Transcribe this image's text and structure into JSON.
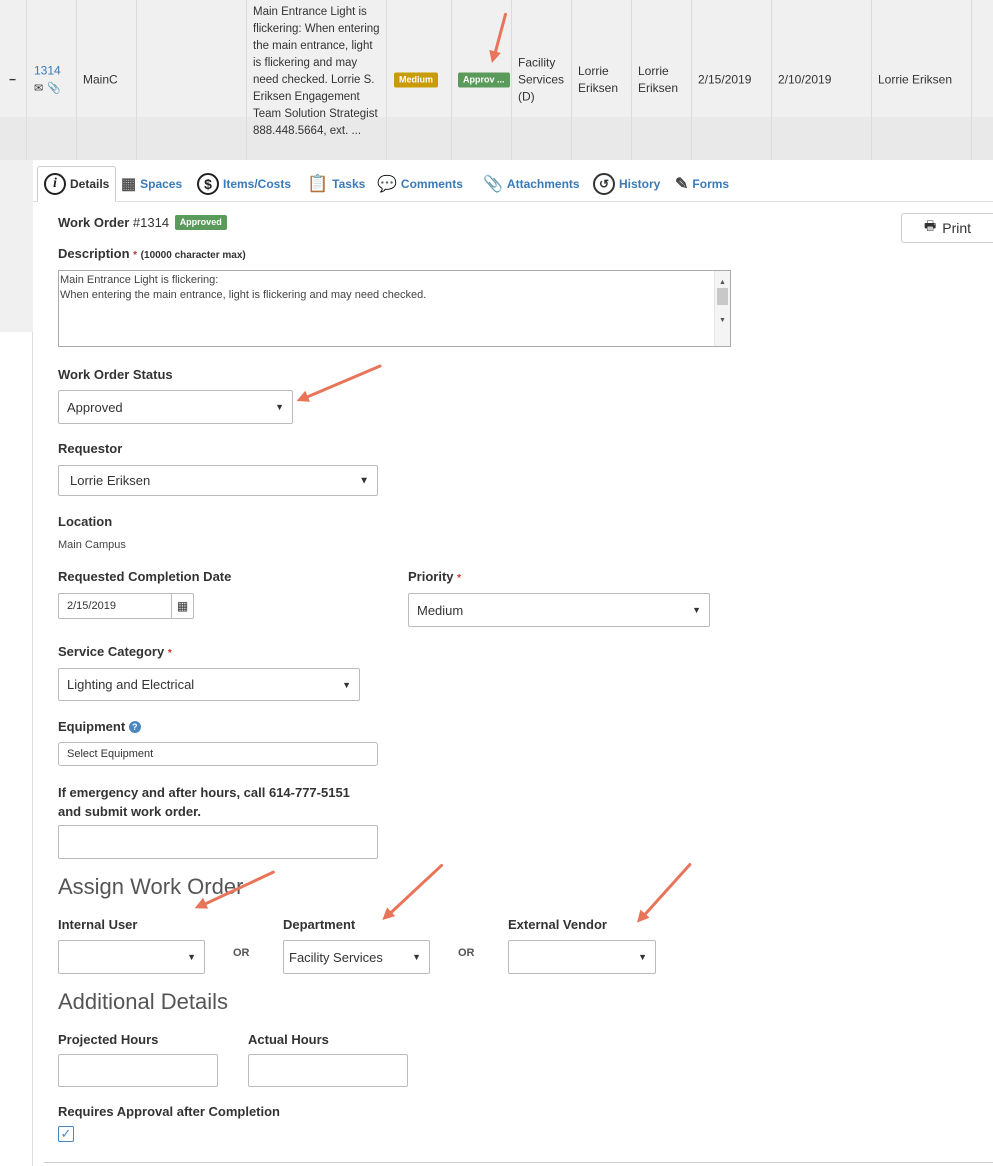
{
  "row": {
    "collapse": "−",
    "id": "1314",
    "location": "MainC",
    "description": "Main Entrance Light is flickering: When entering the main entrance, light is flickering and may need checked. Lorrie S. Eriksen Engagement Team Solution Strategist 888.448.5664, ext. ...",
    "priority": "Medium",
    "status": "Approv ...",
    "department": "Facility Services (D)",
    "requestor": "Lorrie Eriksen",
    "created_by": "Lorrie Eriksen",
    "due": "2/15/2019",
    "requested": "2/10/2019",
    "contact": "Lorrie Eriksen"
  },
  "tabs": [
    "Details",
    "Spaces",
    "Items/Costs",
    "Tasks",
    "Comments",
    "Attachments",
    "History",
    "Forms"
  ],
  "form": {
    "wo_label": "Work Order",
    "wo_number": "#1314",
    "wo_badge": "Approved",
    "print": "Print",
    "desc_label": "Description",
    "desc_hint": "(10000 character max)",
    "desc_value_line1": "Main Entrance Light is flickering:",
    "desc_value_line2": "When entering the main entrance, light is flickering and may need checked.",
    "status_label": "Work Order Status",
    "status_value": "Approved",
    "requestor_label": "Requestor",
    "requestor_value": "Lorrie Eriksen",
    "location_label": "Location",
    "location_value": "Main Campus",
    "rcd_label": "Requested Completion Date",
    "rcd_value": "2/15/2019",
    "priority_label": "Priority",
    "priority_value": "Medium",
    "service_label": "Service Category",
    "service_value": "Lighting and Electrical",
    "equipment_label": "Equipment",
    "equipment_value": "Select Equipment",
    "emergency_line1": "If emergency and after hours, call 614-777-5151",
    "emergency_line2": "and submit work order.",
    "assign_heading": "Assign Work Order",
    "internal_label": "Internal User",
    "dept_label": "Department",
    "dept_value": "Facility Services",
    "vendor_label": "External Vendor",
    "or": "OR",
    "additional_heading": "Additional Details",
    "proj_label": "Projected Hours",
    "actual_label": "Actual Hours",
    "approval_label": "Requires Approval after Completion",
    "approval_checked": "✓",
    "req_star": "*"
  },
  "colors": {
    "accent": "#3a7ab8",
    "medium": "#c99a0a",
    "approved": "#5a9a5a",
    "arrow": "#e8755a"
  }
}
